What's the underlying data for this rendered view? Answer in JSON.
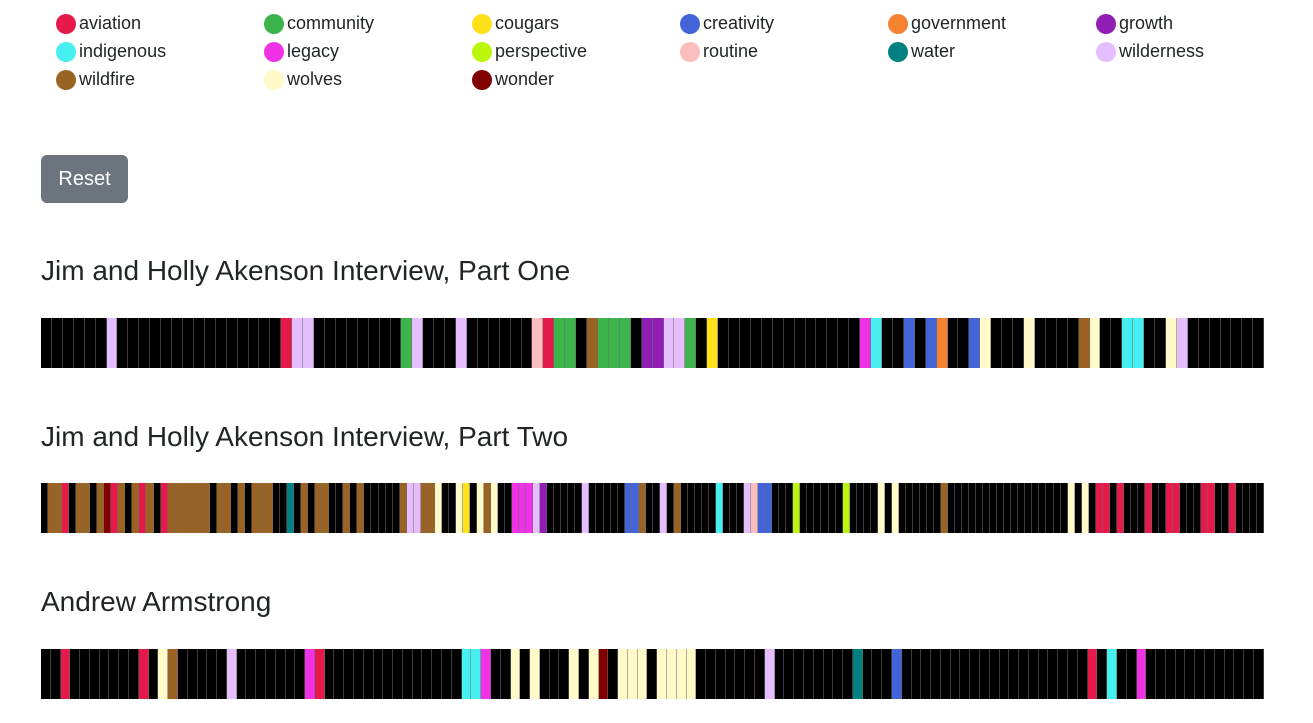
{
  "legend": [
    {
      "topic": "aviation",
      "color": "#e6194b"
    },
    {
      "topic": "community",
      "color": "#3cb44b"
    },
    {
      "topic": "cougars",
      "color": "#ffe119"
    },
    {
      "topic": "creativity",
      "color": "#4363d8"
    },
    {
      "topic": "government",
      "color": "#f58231"
    },
    {
      "topic": "growth",
      "color": "#911eb4"
    },
    {
      "topic": "indigenous",
      "color": "#46f0f0"
    },
    {
      "topic": "legacy",
      "color": "#f032e6"
    },
    {
      "topic": "perspective",
      "color": "#bcf60c"
    },
    {
      "topic": "routine",
      "color": "#fabebe"
    },
    {
      "topic": "water",
      "color": "#008080"
    },
    {
      "topic": "wilderness",
      "color": "#e6beff"
    },
    {
      "topic": "wildfire",
      "color": "#9a6324"
    },
    {
      "topic": "wolves",
      "color": "#fffac8"
    },
    {
      "topic": "wonder",
      "color": "#800000"
    }
  ],
  "reset_label": "Reset",
  "untagged_color": "#000000",
  "chart_data": {
    "type": "table",
    "description": "Topic timelines per interview; each segment is a transcript chunk colored by topic (null = untagged, black)",
    "interviews": [
      {
        "title": "Jim and Holly Akenson Interview, Part One",
        "segments": [
          [
            null,
            6
          ],
          [
            "wilderness",
            1
          ],
          [
            null,
            15
          ],
          [
            "aviation",
            1
          ],
          [
            "wilderness",
            2
          ],
          [
            null,
            8
          ],
          [
            "community",
            1
          ],
          [
            "wilderness",
            1
          ],
          [
            null,
            3
          ],
          [
            "wilderness",
            1
          ],
          [
            null,
            6
          ],
          [
            "routine",
            1
          ],
          [
            "aviation",
            1
          ],
          [
            "community",
            2
          ],
          [
            null,
            1
          ],
          [
            "wildfire",
            1
          ],
          [
            "community",
            3
          ],
          [
            null,
            1
          ],
          [
            "growth",
            2
          ],
          [
            "wilderness",
            2
          ],
          [
            "community",
            1
          ],
          [
            null,
            1
          ],
          [
            "cougars",
            1
          ],
          [
            null,
            13
          ],
          [
            "legacy",
            1
          ],
          [
            "indigenous",
            1
          ],
          [
            null,
            2
          ],
          [
            "creativity",
            1
          ],
          [
            null,
            1
          ],
          [
            "creativity",
            1
          ],
          [
            "government",
            1
          ],
          [
            null,
            2
          ],
          [
            "creativity",
            1
          ],
          [
            "wolves",
            1
          ],
          [
            null,
            3
          ],
          [
            "wolves",
            1
          ],
          [
            null,
            4
          ],
          [
            "wildfire",
            1
          ],
          [
            "wolves",
            1
          ],
          [
            null,
            2
          ],
          [
            "indigenous",
            2
          ],
          [
            null,
            2
          ],
          [
            "wolves",
            1
          ],
          [
            "wilderness",
            1
          ],
          [
            null,
            7
          ]
        ]
      },
      {
        "title": "Jim and Holly Akenson Interview, Part Two",
        "segments": [
          [
            null,
            1
          ],
          [
            "wildfire",
            2
          ],
          [
            "aviation",
            1
          ],
          [
            null,
            1
          ],
          [
            "wildfire",
            2
          ],
          [
            null,
            1
          ],
          [
            "wildfire",
            1
          ],
          [
            "wonder",
            1
          ],
          [
            "aviation",
            1
          ],
          [
            "wildfire",
            1
          ],
          [
            null,
            1
          ],
          [
            "wildfire",
            1
          ],
          [
            "aviation",
            1
          ],
          [
            "wildfire",
            1
          ],
          [
            null,
            1
          ],
          [
            "aviation",
            1
          ],
          [
            "wildfire",
            6
          ],
          [
            null,
            1
          ],
          [
            "wildfire",
            2
          ],
          [
            null,
            1
          ],
          [
            "wildfire",
            1
          ],
          [
            null,
            1
          ],
          [
            "wildfire",
            3
          ],
          [
            null,
            2
          ],
          [
            "water",
            1
          ],
          [
            null,
            1
          ],
          [
            "wildfire",
            1
          ],
          [
            null,
            1
          ],
          [
            "wildfire",
            2
          ],
          [
            null,
            2
          ],
          [
            "wildfire",
            1
          ],
          [
            null,
            1
          ],
          [
            "wildfire",
            1
          ],
          [
            null,
            5
          ],
          [
            "wildfire",
            1
          ],
          [
            "wilderness",
            2
          ],
          [
            "wildfire",
            2
          ],
          [
            "wolves",
            1
          ],
          [
            null,
            2
          ],
          [
            "wolves",
            1
          ],
          [
            "cougars",
            1
          ],
          [
            null,
            1
          ],
          [
            "wolves",
            1
          ],
          [
            "wildfire",
            1
          ],
          [
            "wolves",
            1
          ],
          [
            null,
            2
          ],
          [
            "legacy",
            3
          ],
          [
            "wilderness",
            1
          ],
          [
            "growth",
            1
          ],
          [
            null,
            5
          ],
          [
            "wilderness",
            1
          ],
          [
            null,
            5
          ],
          [
            "creativity",
            2
          ],
          [
            "wildfire",
            1
          ],
          [
            null,
            2
          ],
          [
            "wilderness",
            1
          ],
          [
            null,
            1
          ],
          [
            "wildfire",
            1
          ],
          [
            null,
            5
          ],
          [
            "indigenous",
            1
          ],
          [
            null,
            3
          ],
          [
            "wilderness",
            1
          ],
          [
            "routine",
            1
          ],
          [
            "creativity",
            2
          ],
          [
            null,
            3
          ],
          [
            "perspective",
            1
          ],
          [
            null,
            6
          ],
          [
            "perspective",
            1
          ],
          [
            null,
            4
          ],
          [
            "wolves",
            1
          ],
          [
            null,
            1
          ],
          [
            "wolves",
            1
          ],
          [
            null,
            6
          ],
          [
            "wildfire",
            1
          ],
          [
            null,
            17
          ],
          [
            "wolves",
            1
          ],
          [
            null,
            1
          ],
          [
            "wolves",
            1
          ],
          [
            null,
            1
          ],
          [
            "aviation",
            2
          ],
          [
            null,
            1
          ],
          [
            "aviation",
            1
          ],
          [
            null,
            3
          ],
          [
            "aviation",
            1
          ],
          [
            null,
            2
          ],
          [
            "aviation",
            2
          ],
          [
            null,
            3
          ],
          [
            "aviation",
            2
          ],
          [
            null,
            2
          ],
          [
            "aviation",
            1
          ],
          [
            null,
            4
          ]
        ]
      },
      {
        "title": "Andrew Armstrong",
        "segments": [
          [
            null,
            2
          ],
          [
            "aviation",
            1
          ],
          [
            null,
            7
          ],
          [
            "aviation",
            1
          ],
          [
            null,
            1
          ],
          [
            "wolves",
            1
          ],
          [
            "wildfire",
            1
          ],
          [
            null,
            5
          ],
          [
            "wilderness",
            1
          ],
          [
            null,
            7
          ],
          [
            "legacy",
            1
          ],
          [
            "aviation",
            1
          ],
          [
            null,
            14
          ],
          [
            "indigenous",
            2
          ],
          [
            "legacy",
            1
          ],
          [
            null,
            2
          ],
          [
            "wolves",
            1
          ],
          [
            null,
            1
          ],
          [
            "wolves",
            1
          ],
          [
            null,
            3
          ],
          [
            "wolves",
            1
          ],
          [
            null,
            1
          ],
          [
            "wolves",
            1
          ],
          [
            "wonder",
            1
          ],
          [
            null,
            1
          ],
          [
            "wolves",
            3
          ],
          [
            null,
            1
          ],
          [
            "wolves",
            4
          ],
          [
            null,
            7
          ],
          [
            "wilderness",
            1
          ],
          [
            null,
            8
          ],
          [
            "water",
            1
          ],
          [
            null,
            3
          ],
          [
            "creativity",
            1
          ],
          [
            null,
            19
          ],
          [
            "aviation",
            1
          ],
          [
            null,
            1
          ],
          [
            "indigenous",
            1
          ],
          [
            null,
            2
          ],
          [
            "legacy",
            1
          ],
          [
            null,
            12
          ]
        ]
      }
    ]
  }
}
